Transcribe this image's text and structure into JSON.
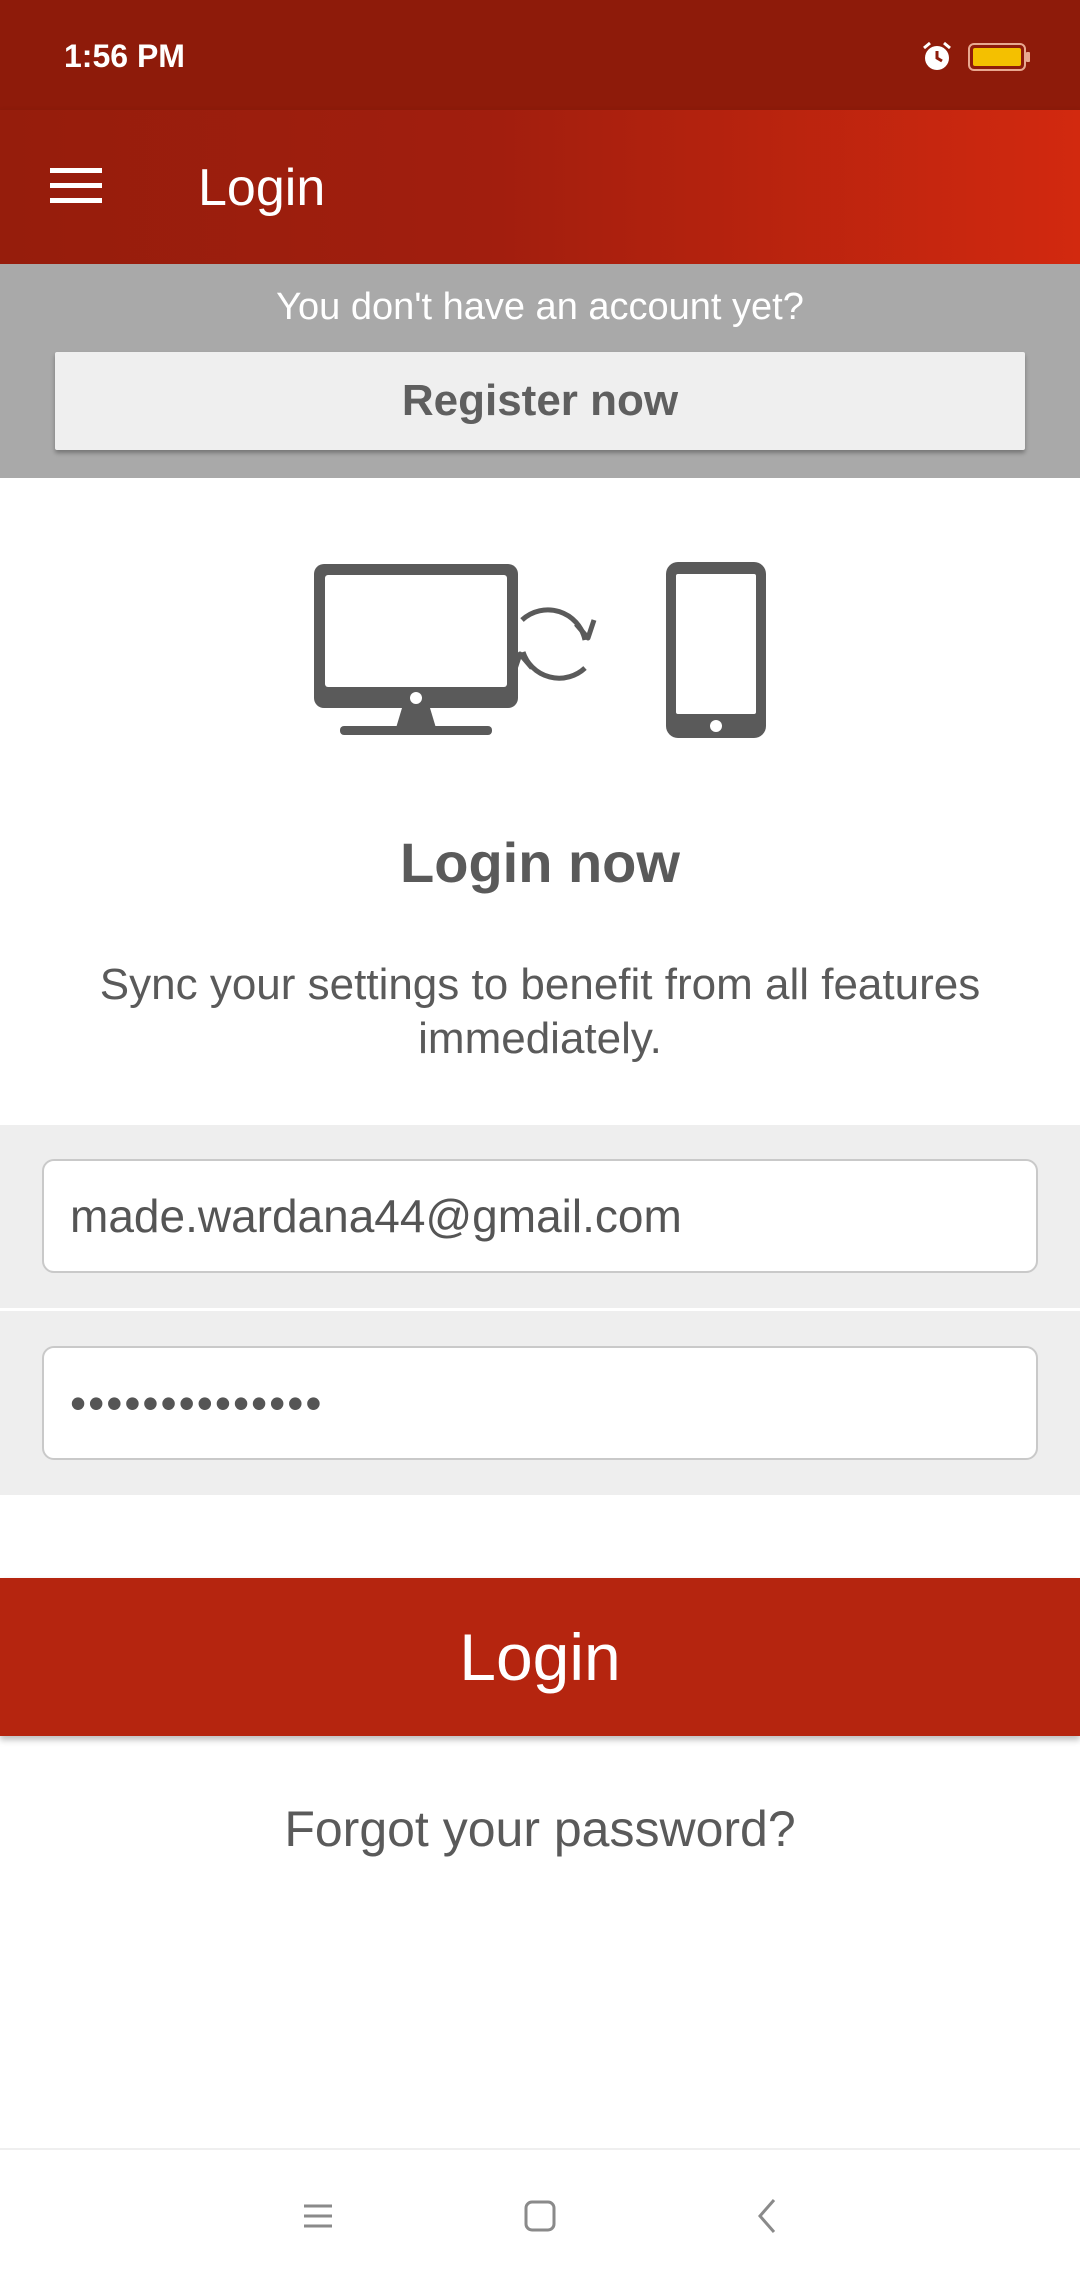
{
  "status_bar": {
    "time": "1:56 PM",
    "icons": [
      "alarm-icon",
      "battery-icon"
    ],
    "battery_color": "#f4c000"
  },
  "app_bar": {
    "title": "Login",
    "menu_icon": "hamburger-menu-icon",
    "gradient": [
      "#961d0c",
      "#d2290f"
    ]
  },
  "register": {
    "prompt": "You don't have an account yet?",
    "button_label": "Register now"
  },
  "hero": {
    "icons": [
      "desktop-monitor-icon",
      "sync-icon",
      "smartphone-icon"
    ]
  },
  "content": {
    "heading": "Login now",
    "description": "Sync your settings to benefit from all features immediately."
  },
  "form": {
    "email_value": "made.wardana44@gmail.com",
    "password_masked": "••••••••••••••"
  },
  "actions": {
    "login_label": "Login",
    "forgot_label": "Forgot your password?"
  },
  "nav_bar": {
    "icons": [
      "recent-apps-icon",
      "home-icon",
      "back-icon"
    ]
  },
  "colors": {
    "status_bar": "#8e1b0a",
    "primary": "#b5250f",
    "register_panel": "#a9a9a9",
    "text": "#5a5a5a"
  }
}
